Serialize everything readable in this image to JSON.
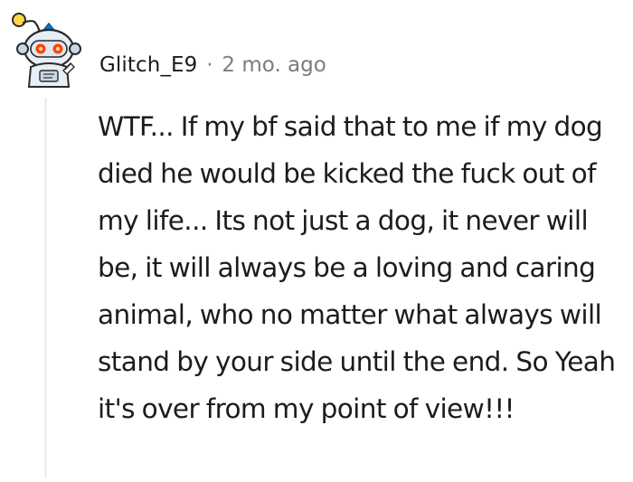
{
  "comment": {
    "username": "Glitch_E9",
    "separator": "·",
    "timestamp": "2 mo. ago",
    "avatar_icon": "snoo-robot-avatar-icon",
    "body": "WTF... If my bf said that to me if my dog died he would be kicked the fuck out of my life... Its not just a dog, it never will be, it will always be a loving and caring animal, who no matter what always will stand by your side until the end. So Yeah it's over from my point of view!!!"
  },
  "colors": {
    "text": "#1c1c1c",
    "meta": "#7c7c7c",
    "thread_line": "#edeff1",
    "avatar_accent": "#0079d3",
    "avatar_eye": "#ff4500"
  }
}
